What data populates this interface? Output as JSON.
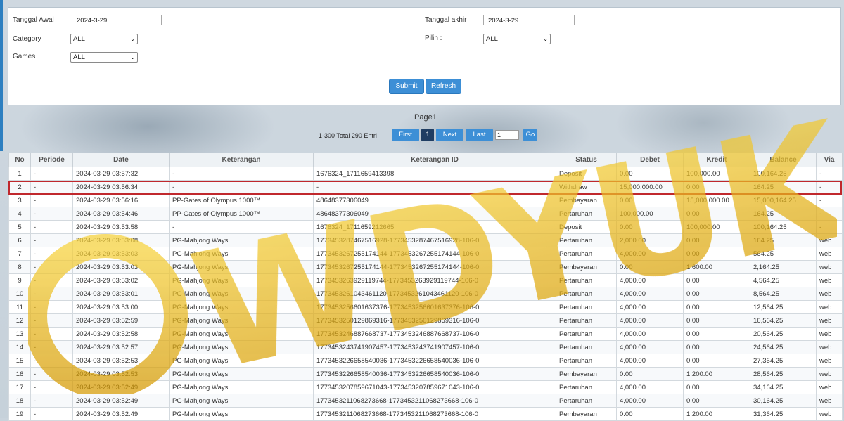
{
  "filters": {
    "tanggal_awal_label": "Tanggal Awal",
    "tanggal_awal_value": "2024-3-29",
    "tanggal_akhir_label": "Tanggal akhir",
    "tanggal_akhir_value": "2024-3-29",
    "category_label": "Category",
    "category_value": "ALL",
    "pilih_label": "Pilih :",
    "pilih_value": "ALL",
    "games_label": "Games",
    "games_value": "ALL",
    "submit_label": "Submit",
    "refresh_label": "Refresh"
  },
  "pager": {
    "title": "Page1",
    "total": "1-300 Total 290 Entri",
    "first": "First",
    "current": "1",
    "next": "Next",
    "last": "Last",
    "jump_value": "1",
    "go": "Go"
  },
  "table": {
    "headers": [
      "No",
      "Periode",
      "Date",
      "Keterangan",
      "Keterangan ID",
      "Status",
      "Debet",
      "Kredit",
      "Balance",
      "Via"
    ],
    "rows": [
      [
        "1",
        "-",
        "2024-03-29 03:57:32",
        "-",
        "1676324_1711659413398",
        "Deposit",
        "0.00",
        "100,000.00",
        "100,164.25",
        "-"
      ],
      [
        "2",
        "-",
        "2024-03-29 03:56:34",
        "-",
        "-",
        "Withdraw",
        "15,000,000.00",
        "0.00",
        "164.25",
        "-"
      ],
      [
        "3",
        "-",
        "2024-03-29 03:56:16",
        "PP-Gates of Olympus 1000™",
        "48648377306049",
        "Pembayaran",
        "0.00",
        "15,000,000.00",
        "15,000,164.25",
        "-"
      ],
      [
        "4",
        "-",
        "2024-03-29 03:54:46",
        "PP-Gates of Olympus 1000™",
        "48648377306049",
        "Pertaruhan",
        "100,000.00",
        "0.00",
        "164.25",
        "-"
      ],
      [
        "5",
        "-",
        "2024-03-29 03:53:58",
        "-",
        "1676324_1711659212665",
        "Deposit",
        "0.00",
        "100,000.00",
        "100,164.25",
        "-"
      ],
      [
        "6",
        "-",
        "2024-03-29 03:53:08",
        "PG-Mahjong Ways",
        "1773453287467516928-1773453287467516928-106-0",
        "Pertaruhan",
        "2,000.00",
        "0.00",
        "164.25",
        "web"
      ],
      [
        "7",
        "-",
        "2024-03-29 03:53:03",
        "PG-Mahjong Ways",
        "1773453267255174144-1773453267255174144-106-0",
        "Pertaruhan",
        "4,000.00",
        "0.00",
        "564.25",
        "web"
      ],
      [
        "8",
        "-",
        "2024-03-29 03:53:03",
        "PG-Mahjong Ways",
        "1773453267255174144-1773453267255174144-106-0",
        "Pembayaran",
        "0.00",
        "1,600.00",
        "2,164.25",
        "web"
      ],
      [
        "9",
        "-",
        "2024-03-29 03:53:02",
        "PG-Mahjong Ways",
        "1773453263929119744-1773453263929119744-106-0",
        "Pertaruhan",
        "4,000.00",
        "0.00",
        "4,564.25",
        "web"
      ],
      [
        "10",
        "-",
        "2024-03-29 03:53:01",
        "PG-Mahjong Ways",
        "1773453261043461120-1773453261043461120-106-0",
        "Pertaruhan",
        "4,000.00",
        "0.00",
        "8,564.25",
        "web"
      ],
      [
        "11",
        "-",
        "2024-03-29 03:53:00",
        "PG-Mahjong Ways",
        "1773453256601637376-1773453256601637376-106-0",
        "Pertaruhan",
        "4,000.00",
        "0.00",
        "12,564.25",
        "web"
      ],
      [
        "12",
        "-",
        "2024-03-29 03:52:59",
        "PG-Mahjong Ways",
        "1773453250129869316-1773453250129869316-106-0",
        "Pertaruhan",
        "4,000.00",
        "0.00",
        "16,564.25",
        "web"
      ],
      [
        "13",
        "-",
        "2024-03-29 03:52:58",
        "PG-Mahjong Ways",
        "1773453246887668737-1773453246887668737-106-0",
        "Pertaruhan",
        "4,000.00",
        "0.00",
        "20,564.25",
        "web"
      ],
      [
        "14",
        "-",
        "2024-03-29 03:52:57",
        "PG-Mahjong Ways",
        "1773453243741907457-1773453243741907457-106-0",
        "Pertaruhan",
        "4,000.00",
        "0.00",
        "24,564.25",
        "web"
      ],
      [
        "15",
        "-",
        "2024-03-29 03:52:53",
        "PG-Mahjong Ways",
        "1773453226658540036-1773453226658540036-106-0",
        "Pertaruhan",
        "4,000.00",
        "0.00",
        "27,364.25",
        "web"
      ],
      [
        "16",
        "-",
        "2024-03-29 03:52:53",
        "PG-Mahjong Ways",
        "1773453226658540036-1773453226658540036-106-0",
        "Pembayaran",
        "0.00",
        "1,200.00",
        "28,564.25",
        "web"
      ],
      [
        "17",
        "-",
        "2024-03-29 03:52:49",
        "PG-Mahjong Ways",
        "1773453207859671043-1773453207859671043-106-0",
        "Pertaruhan",
        "4,000.00",
        "0.00",
        "34,164.25",
        "web"
      ],
      [
        "18",
        "-",
        "2024-03-29 03:52:49",
        "PG-Mahjong Ways",
        "1773453211068273668-1773453211068273668-106-0",
        "Pertaruhan",
        "4,000.00",
        "0.00",
        "30,164.25",
        "web"
      ],
      [
        "19",
        "-",
        "2024-03-29 03:52:49",
        "PG-Mahjong Ways",
        "1773453211068273668-1773453211068273668-106-0",
        "Pembayaran",
        "0.00",
        "1,200.00",
        "31,364.25",
        "web"
      ]
    ]
  },
  "colors": {
    "accent_button": "#3d8fd6",
    "active_page": "#1f3d63",
    "credit_green": "#2a8a2a",
    "withdraw_red": "#e02020",
    "highlight_border": "#c0282d"
  },
  "watermark": {
    "text": "WDYUK",
    "color": "#e8b400"
  }
}
